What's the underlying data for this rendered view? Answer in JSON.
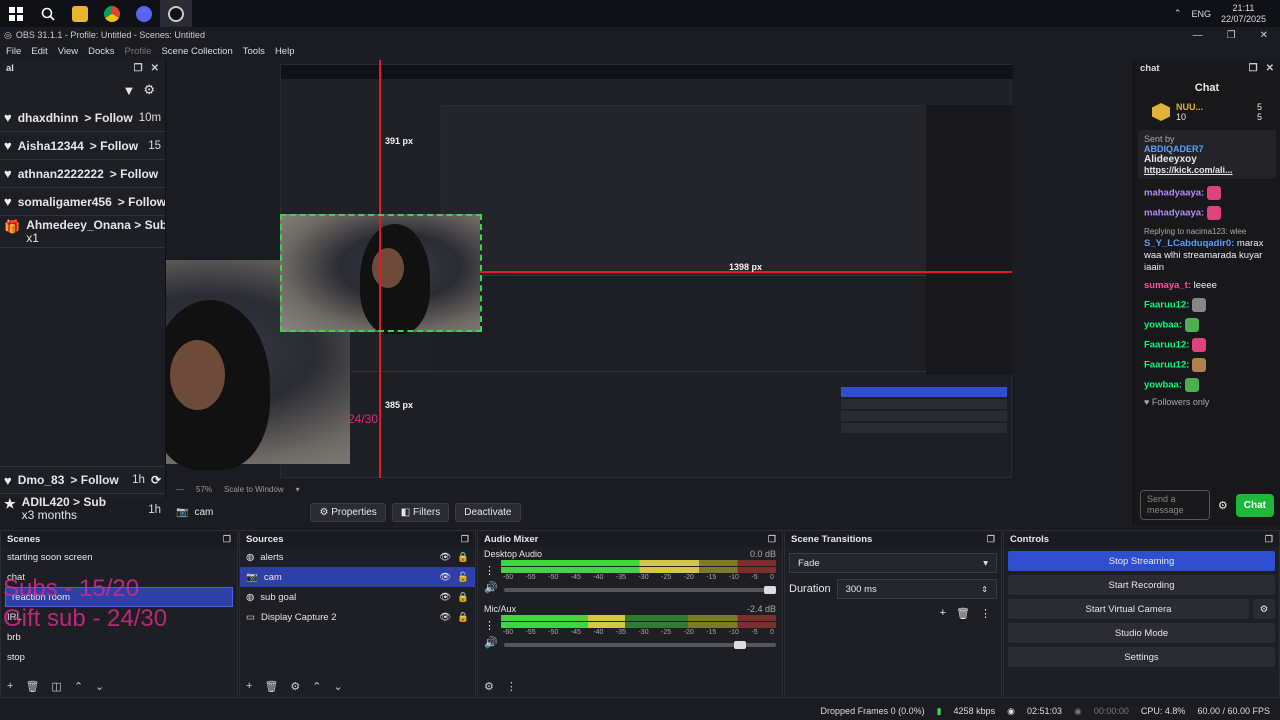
{
  "taskbar": {
    "icons": [
      "windows-icon",
      "search-icon",
      "file-explorer-icon",
      "chrome-icon",
      "discord-icon",
      "obs-icon"
    ],
    "lang": "ENG",
    "time": "21:11",
    "date": "22/07/2025"
  },
  "window": {
    "title": "OBS 31.1.1 - Profile: Untitled - Scenes: Untitled"
  },
  "menu": [
    "File",
    "Edit",
    "View",
    "Docks",
    "Profile",
    "Scene Collection",
    "Tools",
    "Help"
  ],
  "activity_feed": {
    "title": "al",
    "items": [
      {
        "user": "dhaxdhinn",
        "action": "> Follow",
        "time": "10m"
      },
      {
        "user": "Aisha12344",
        "action": "> Follow",
        "time": "15"
      },
      {
        "user": "athnan2222222",
        "action": "> Follow",
        "time": ""
      },
      {
        "user": "somaligamer456",
        "action": "> Follow",
        "time": ""
      },
      {
        "user": "Ahmedeey_Onana",
        "action": "> Subs",
        "sub": "x1",
        "time": ""
      },
      {
        "user": "Dmo_83",
        "action": "> Follow",
        "time": "1h"
      },
      {
        "user": "ADIL420",
        "action": "> Sub",
        "sub": "x3 months",
        "time": "1h"
      }
    ]
  },
  "preview": {
    "ruler_v": "391 px",
    "ruler_h": "1398 px",
    "ruler_small": "385 px",
    "overlay_fraction": "24/30",
    "zoom": "57%",
    "zoom_mode": "Scale to Window"
  },
  "context_bar": {
    "source": "cam",
    "properties": "Properties",
    "filters": "Filters",
    "deactivate": "Deactivate"
  },
  "chat": {
    "dock_title": "chat",
    "title": "Chat",
    "leaderboard_user": "NUU...",
    "leaderboard_count": "10",
    "counts": [
      "5",
      "5"
    ],
    "pinned_label": "Sent by",
    "pinned_user": "ABDIQADER7",
    "pinned_text": "Alideeyxoy",
    "pinned_link": "https://kick.com/ali...",
    "messages": [
      {
        "user": "mahadyaaya:",
        "text": "",
        "color": "p"
      },
      {
        "user": "mahadyaaya:",
        "text": "",
        "color": "p"
      },
      {
        "user": "S_Y_LCabduqadir0:",
        "text": "marax waa wlhi streamarada kuyar iaain",
        "color": "b",
        "reply": "Replying to nacima123: wlee"
      },
      {
        "user": "sumaya_t:",
        "text": "leeee",
        "color": "p"
      },
      {
        "user": "Faaruu12:",
        "text": "",
        "color": "g"
      },
      {
        "user": "yowbaa:",
        "text": "",
        "color": "g"
      },
      {
        "user": "Faaruu12:",
        "text": "",
        "color": "g"
      },
      {
        "user": "Faaruu12:",
        "text": "",
        "color": "g"
      },
      {
        "user": "yowbaa:",
        "text": "",
        "color": "g"
      }
    ],
    "followers_only": "Followers only",
    "send_placeholder": "Send a message",
    "chat_button": "Chat"
  },
  "scenes": {
    "title": "Scenes",
    "items": [
      "starting soon screen",
      "chat",
      "reaction room",
      "IRL",
      "brb",
      "stop"
    ],
    "selected": 2,
    "overlay_line1": "Subs - 15/20",
    "overlay_line2": "Gift sub - 24/30"
  },
  "sources": {
    "title": "Sources",
    "items": [
      {
        "name": "alerts",
        "icon": "browser-icon"
      },
      {
        "name": "cam",
        "icon": "camera-icon"
      },
      {
        "name": "sub goal",
        "icon": "browser-icon"
      },
      {
        "name": "Display Capture 2",
        "icon": "display-icon"
      }
    ],
    "selected": 1
  },
  "mixer": {
    "title": "Audio Mixer",
    "tracks": [
      {
        "name": "Desktop Audio",
        "db": "0.0 dB",
        "level": 0.72
      },
      {
        "name": "Mic/Aux",
        "db": "-2.4 dB",
        "level": 0.45
      }
    ],
    "scale": [
      "-60",
      "-55",
      "-50",
      "-45",
      "-40",
      "-35",
      "-30",
      "-25",
      "-20",
      "-15",
      "-10",
      "-5",
      "0"
    ]
  },
  "transitions": {
    "title": "Scene Transitions",
    "transition": "Fade",
    "duration_label": "Duration",
    "duration": "300 ms"
  },
  "controls": {
    "title": "Controls",
    "buttons": [
      "Stop Streaming",
      "Start Recording",
      "Start Virtual Camera",
      "Studio Mode",
      "Settings"
    ]
  },
  "status": {
    "dropped": "Dropped Frames 0 (0.0%)",
    "kbps": "4258 kbps",
    "live": "02:51:03",
    "rec": "00:00:00",
    "cpu": "CPU: 4.8%",
    "fps": "60.00 / 60.00 FPS"
  }
}
